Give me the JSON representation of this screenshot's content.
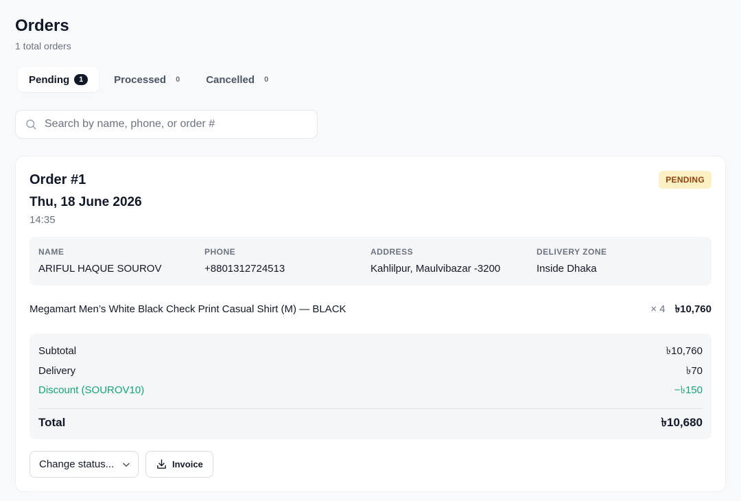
{
  "header": {
    "title": "Orders",
    "subtitle": "1 total orders"
  },
  "tabs": [
    {
      "label": "Pending",
      "count": "1",
      "active": true
    },
    {
      "label": "Processed",
      "count": "0",
      "active": false
    },
    {
      "label": "Cancelled",
      "count": "0",
      "active": false
    }
  ],
  "search": {
    "placeholder": "Search by name, phone, or order #",
    "value": ""
  },
  "order": {
    "number": "Order #1",
    "date": "Thu, 18 June 2026",
    "time": "14:35",
    "status": "PENDING",
    "customer": [
      {
        "label": "NAME",
        "value": "ARIFUL HAQUE SOUROV"
      },
      {
        "label": "PHONE",
        "value": "+8801312724513"
      },
      {
        "label": "ADDRESS",
        "value": "Kahlilpur, Maulvibazar -3200"
      },
      {
        "label": "DELIVERY ZONE",
        "value": "Inside Dhaka"
      }
    ],
    "item": {
      "name": "Megamart Men’s White Black Check Print Casual Shirt (M) — BLACK",
      "qty": "× 4",
      "price": "৳10,760"
    },
    "totals": {
      "subtotal_label": "Subtotal",
      "subtotal": "৳10,760",
      "delivery_label": "Delivery",
      "delivery": "৳70",
      "discount_label": "Discount (SOUROV10)",
      "discount": "−৳150",
      "total_label": "Total",
      "total": "৳10,680"
    },
    "actions": {
      "status_select": "Change status...",
      "invoice": "Invoice"
    }
  },
  "colors": {
    "pending_bg": "#fdf0c4",
    "pending_text": "#92400e",
    "discount": "#16a37a"
  }
}
